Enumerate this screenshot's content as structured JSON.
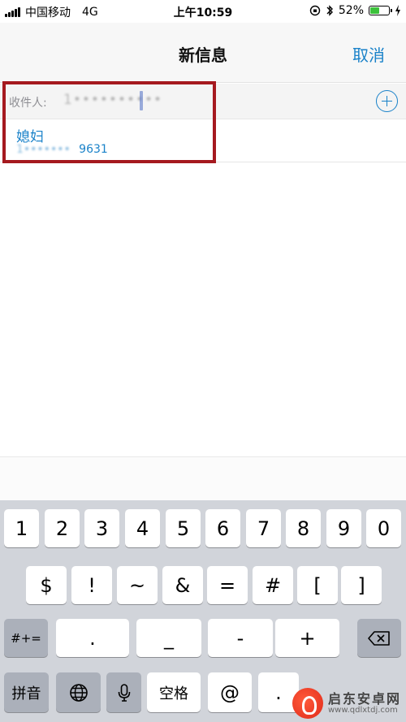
{
  "status_bar": {
    "carrier": "中国移动",
    "network": "4G",
    "time": "上午10:59",
    "battery": "52%",
    "battery_level": 0.52,
    "icons": [
      "signal-icon",
      "orientation-lock-icon",
      "bluetooth-icon",
      "battery-icon",
      "charging-icon"
    ],
    "battery_color": "#3cc13b"
  },
  "nav": {
    "title": "新信息",
    "cancel": "取消",
    "accent_color": "#1a82c9"
  },
  "recipient": {
    "label": "收件人:",
    "value": "1••••••••••",
    "add_icon": "plus-circle-icon"
  },
  "suggestion": {
    "name": "媳妇",
    "number_masked": "1•••••••",
    "number_suffix": "9631"
  },
  "keyboard": {
    "row1": [
      "1",
      "2",
      "3",
      "4",
      "5",
      "6",
      "7",
      "8",
      "9",
      "0"
    ],
    "row2": [
      "$",
      "!",
      "~",
      "&",
      "=",
      "#",
      "[",
      "]"
    ],
    "row3": {
      "switch": "#+=",
      "keys": [
        ".",
        "_",
        "-",
        "+"
      ],
      "delete_icon": "backspace-icon"
    },
    "row4": {
      "pinyin": "拼音",
      "globe_icon": "globe-icon",
      "mic_icon": "microphone-icon",
      "space": "空格",
      "at": "@",
      "dot": "."
    }
  },
  "watermark": {
    "title": "启东安卓网",
    "url": "www.qdlxtdj.com"
  },
  "highlight_color": "#a5191f"
}
